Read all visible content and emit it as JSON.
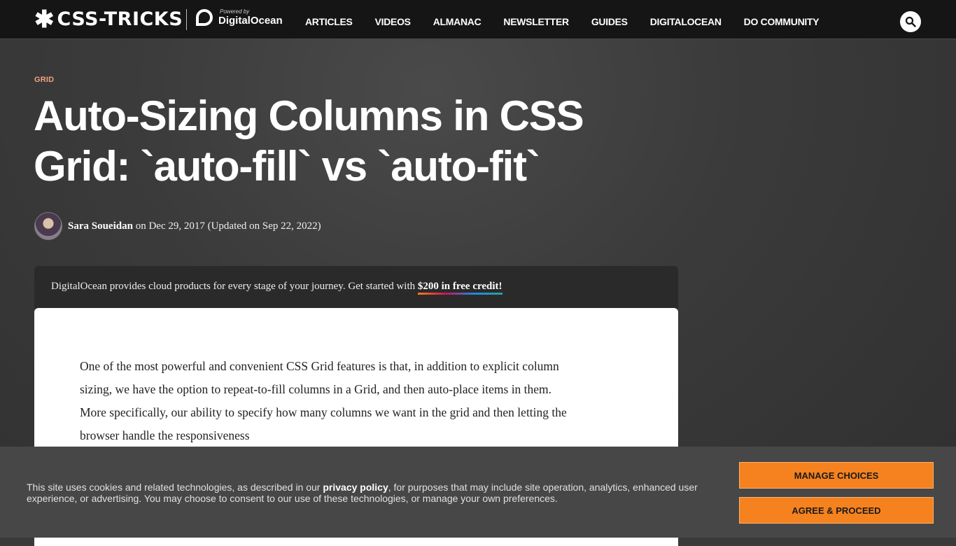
{
  "header": {
    "logo_star": "✱",
    "logo_text": "CSS-TRICKS",
    "powered_by": "Powered by",
    "sponsor_name": "DigitalOcean",
    "nav": [
      "ARTICLES",
      "VIDEOS",
      "ALMANAC",
      "NEWSLETTER",
      "GUIDES",
      "DIGITALOCEAN",
      "DO COMMUNITY"
    ],
    "search_icon": "search-icon"
  },
  "article": {
    "tag": "GRID",
    "title": "Auto-Sizing Columns in CSS Grid: `auto-fill` vs `auto-fit`",
    "author": "Sara Soueidan",
    "date_text": "on Dec 29, 2017 (Updated on Sep 22, 2022)",
    "body": "One of the most powerful and convenient CSS Grid features is that, in addition to explicit column sizing, we have the option to repeat-to-fill columns in a Grid, and then auto-place items in them. More specifically, our ability to specify how many columns we want in the grid and then letting the browser handle the responsiveness"
  },
  "sponsor": {
    "text": "DigitalOcean provides cloud products for every stage of your journey. Get started with",
    "credit": "$200 in free credit!"
  },
  "cookie": {
    "text_before": "This site uses cookies and related technologies, as described in our",
    "link": "privacy policy",
    "text_after": ", for purposes that may include site operation, analytics, enhanced user experience, or advertising. You may choose to consent to our use of these technologies, or manage your own preferences.",
    "manage": "MANAGE CHOICES",
    "agree": "AGREE & PROCEED"
  },
  "colors": {
    "header_bg": "#151515",
    "accent_orange": "#f5821f",
    "tag_color": "#f3a37c"
  }
}
